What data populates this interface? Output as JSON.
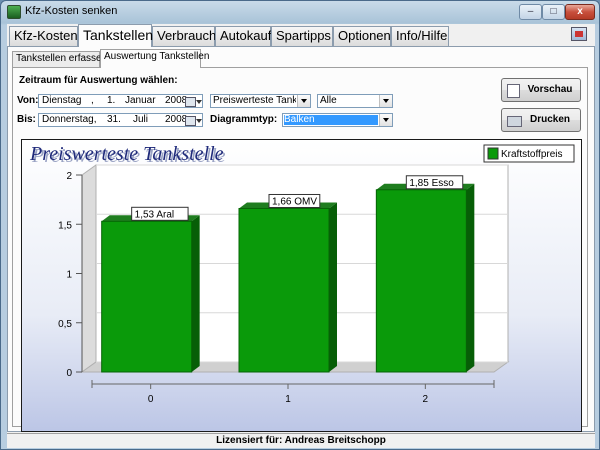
{
  "window": {
    "title": "Kfz-Kosten senken",
    "controls": {
      "minimize": "–",
      "maximize": "□",
      "close": "x"
    }
  },
  "tabs": [
    "Kfz-Kosten",
    "Tankstellen",
    "Verbrauch",
    "Autokauf",
    "Spartipps",
    "Optionen",
    "Info/Hilfe"
  ],
  "active_tab": "Tankstellen",
  "subtabs": [
    "Tankstellen erfassen",
    "Auswertung Tankstellen"
  ],
  "active_subtab": "Auswertung Tankstellen",
  "form": {
    "heading": "Zeitraum für Auswertung wählen:",
    "von_label": "Von:",
    "bis_label": "Bis:",
    "von": {
      "weekday": "Dienstag",
      "day": "1.",
      "month": "Januar",
      "year": "2008"
    },
    "bis": {
      "weekday": "Donnerstag,",
      "day": "31.",
      "month": "Juli",
      "year": "2008"
    },
    "report_select": "Preiswerteste Tankstelle",
    "filter_select": "Alle",
    "diagramm_label": "Diagrammtyp:",
    "diagramm_select": "Balken"
  },
  "buttons": {
    "preview": "Vorschau",
    "print": "Drucken"
  },
  "chart_data": {
    "type": "bar",
    "title": "Preiswerteste Tankstelle",
    "categories": [
      "0",
      "1",
      "2"
    ],
    "series": [
      {
        "name": "Kraftstoffpreis",
        "values": [
          1.53,
          1.66,
          1.85
        ],
        "color": "#0a9a0a"
      }
    ],
    "data_labels": [
      "1,53 Aral",
      "1,66 OMV",
      "1,85 Esso"
    ],
    "y_ticks": [
      "0",
      "0,5",
      "1",
      "1,5",
      "2"
    ],
    "ylim": [
      0,
      2
    ],
    "grid": true,
    "legend": "top-right"
  },
  "status": "Lizensiert für: Andreas Breitschopp"
}
